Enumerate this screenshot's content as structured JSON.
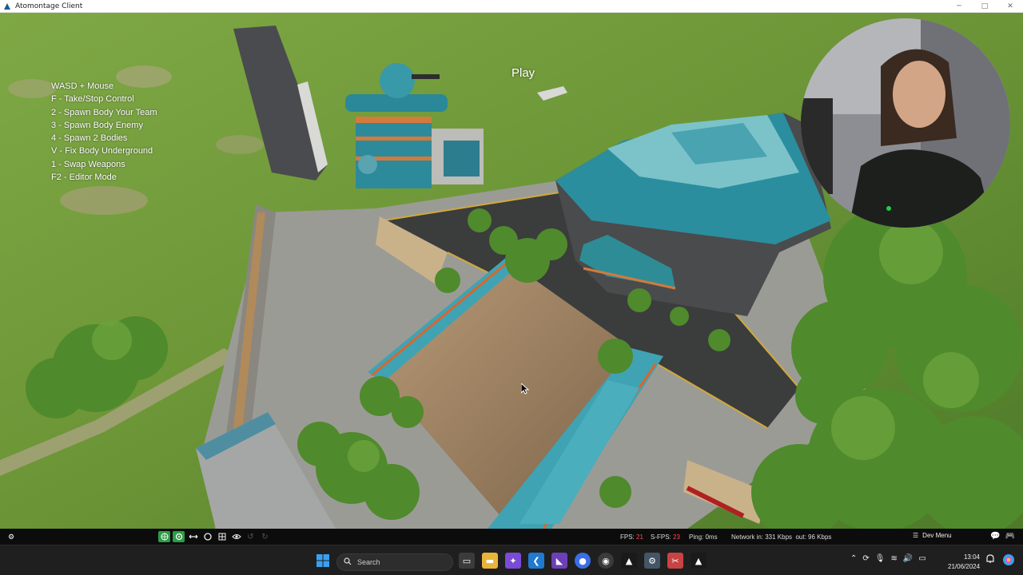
{
  "window": {
    "title": "Atomontage Client",
    "minimize_glyph": "─",
    "maximize_glyph": "□",
    "close_glyph": "✕"
  },
  "game": {
    "help_lines": [
      "WASD + Mouse",
      "F - Take/Stop Control",
      "2 - Spawn Body Your Team",
      "3 - Spawn Body Enemy",
      "4 - Spawn 2 Bodies",
      "V - Fix Body Underground",
      "1 - Swap Weapons",
      "F2 - Editor Mode"
    ],
    "play_label": "Play"
  },
  "statusbar": {
    "fps_label": "FPS:",
    "fps_value": "21",
    "sfps_label": "S-FPS:",
    "sfps_value": "23",
    "ping": "Ping: 0ms",
    "network": "Network in: 331 Kbps  out: 96 Kbps",
    "dev_menu": "Dev Menu",
    "tools": [
      "globe-icon",
      "target-icon",
      "move-icon",
      "circle-icon",
      "grid-icon",
      "eye-icon",
      "undo-icon",
      "redo-icon"
    ]
  },
  "taskbar": {
    "search_placeholder": "Search",
    "time": "13:04",
    "date": "21/06/2024"
  },
  "colors": {
    "grass": "#6f9a3a",
    "teal": "#2e8c96",
    "accent_green": "#2e9c47",
    "fps_red": "#ff4d4d",
    "taskbar_bg": "#1f1f1f"
  }
}
